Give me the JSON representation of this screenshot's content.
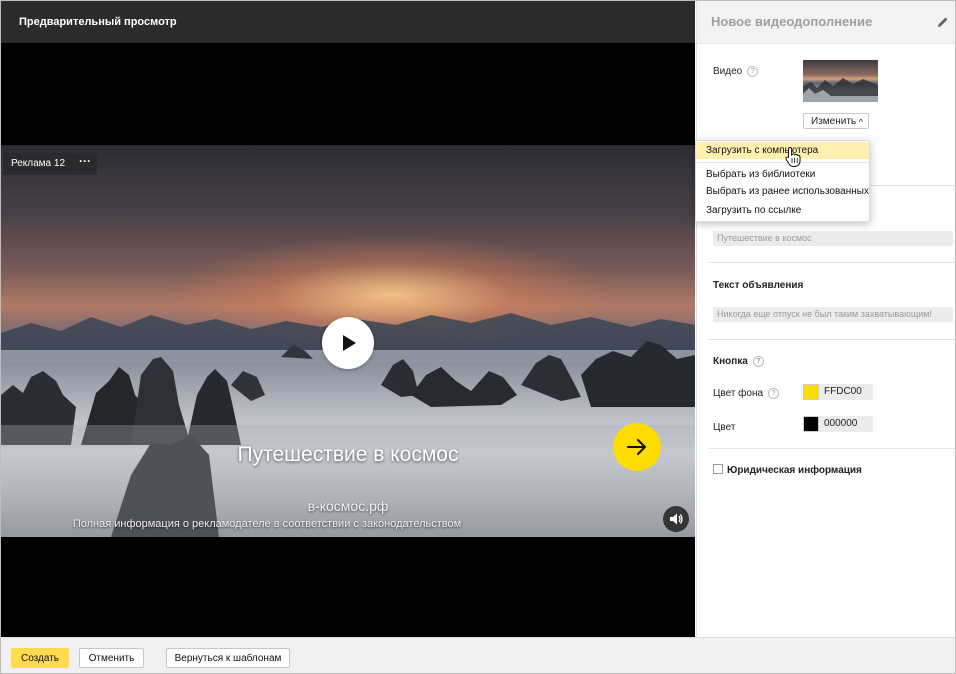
{
  "preview": {
    "title": "Предварительный просмотр",
    "ad_badge": "Реклама 12",
    "more_label": "···",
    "headline": "Путешествие в космос",
    "domain": "в-космос.рф",
    "legal": "Полная информация о рекламодателе в соответствии с законодательством"
  },
  "panel": {
    "title": "Новое видеодополнение",
    "video_label": "Видео",
    "change_button": "Изменить",
    "title_field_placeholder": "Путешествие в космос",
    "text_label": "Текст объявления",
    "text_field_placeholder": "Никогда еще отпуск не был таким захватывающим!",
    "button_section": "Кнопка",
    "bg_color_label": "Цвет фона",
    "bg_color_value": "FFDC00",
    "color_label": "Цвет",
    "color_value": "000000",
    "legal_checkbox_label": "Юридическая информация"
  },
  "dropdown": {
    "items": [
      "Загрузить с компьютера",
      "Выбрать из библиотеки",
      "Выбрать из ранее использованных",
      "Загрузить по ссылке"
    ],
    "active_index": 0
  },
  "footer": {
    "create": "Создать",
    "cancel": "Отменить",
    "back": "Вернуться к шаблонам"
  },
  "colors": {
    "accent": "#FFDC00",
    "text_color": "#000000"
  },
  "icons": [
    "play-icon",
    "arrow-right-icon",
    "sound-icon",
    "pencil-icon",
    "help-icon",
    "chevron-up-icon",
    "hand-cursor-icon"
  ]
}
